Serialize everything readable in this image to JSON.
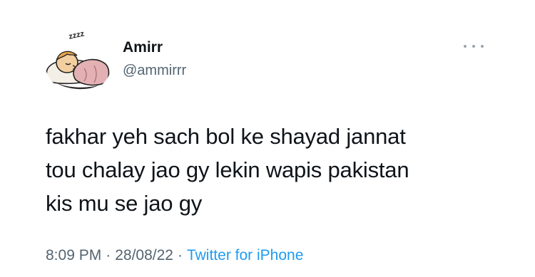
{
  "user": {
    "display_name": "Amirr",
    "handle": "@ammirrr"
  },
  "avatar": {
    "icon": "sleeping-cartoon-avatar",
    "sleep_text": "zzzz"
  },
  "tweet": {
    "lines": [
      "fakhar yeh sach bol ke shayad jannat",
      "tou chalay jao gy lekin wapis pakistan",
      "kis mu se jao gy"
    ]
  },
  "meta": {
    "time": "8:09 PM",
    "separator": "·",
    "date": "28/08/22",
    "source": "Twitter for iPhone"
  },
  "colors": {
    "text": "#0f1419",
    "secondary": "#536471",
    "link": "#1d9bf0"
  }
}
